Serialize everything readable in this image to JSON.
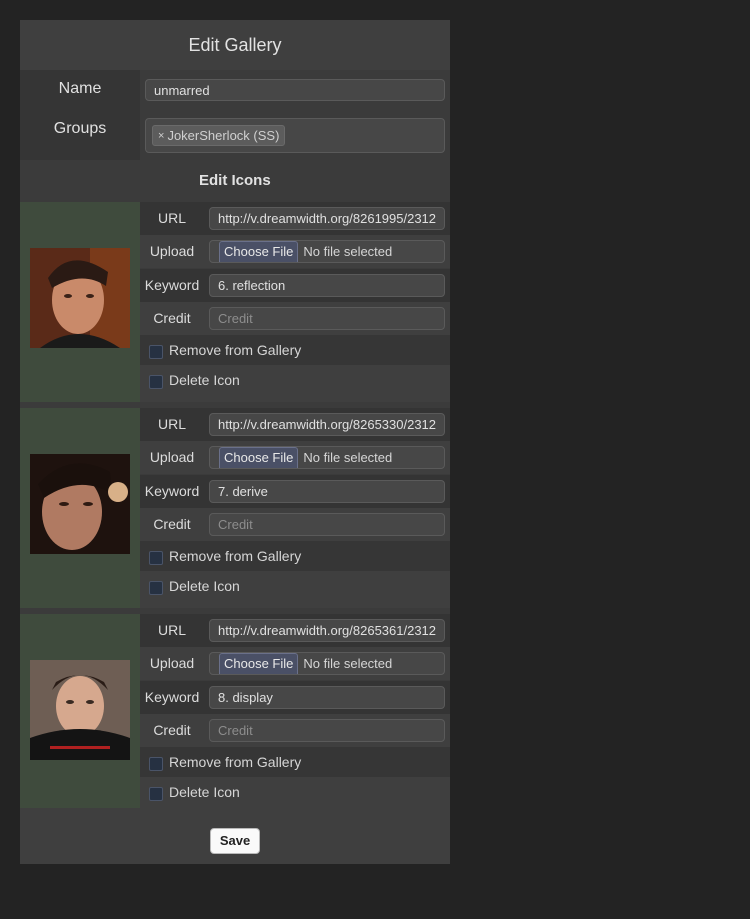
{
  "title": "Edit Gallery",
  "name_label": "Name",
  "name_value": "unmarred",
  "groups_label": "Groups",
  "group_tag": "JokerSherlock (SS)",
  "tag_remove": "×",
  "edit_icons_label": "Edit Icons",
  "labels": {
    "url": "URL",
    "upload": "Upload",
    "keyword": "Keyword",
    "credit": "Credit",
    "choose_file": "Choose File",
    "no_file": "No file selected",
    "credit_placeholder": "Credit",
    "remove": "Remove from Gallery",
    "delete": "Delete Icon"
  },
  "icons": [
    {
      "url": "http://v.dreamwidth.org/8261995/2312",
      "keyword": "6. reflection"
    },
    {
      "url": "http://v.dreamwidth.org/8265330/2312",
      "keyword": "7. derive"
    },
    {
      "url": "http://v.dreamwidth.org/8265361/2312",
      "keyword": "8. display"
    }
  ],
  "save_label": "Save",
  "colors": {
    "panel": "#3b3b3b",
    "thumb_bg": "#3f4b3d",
    "page_bg": "#232323"
  }
}
